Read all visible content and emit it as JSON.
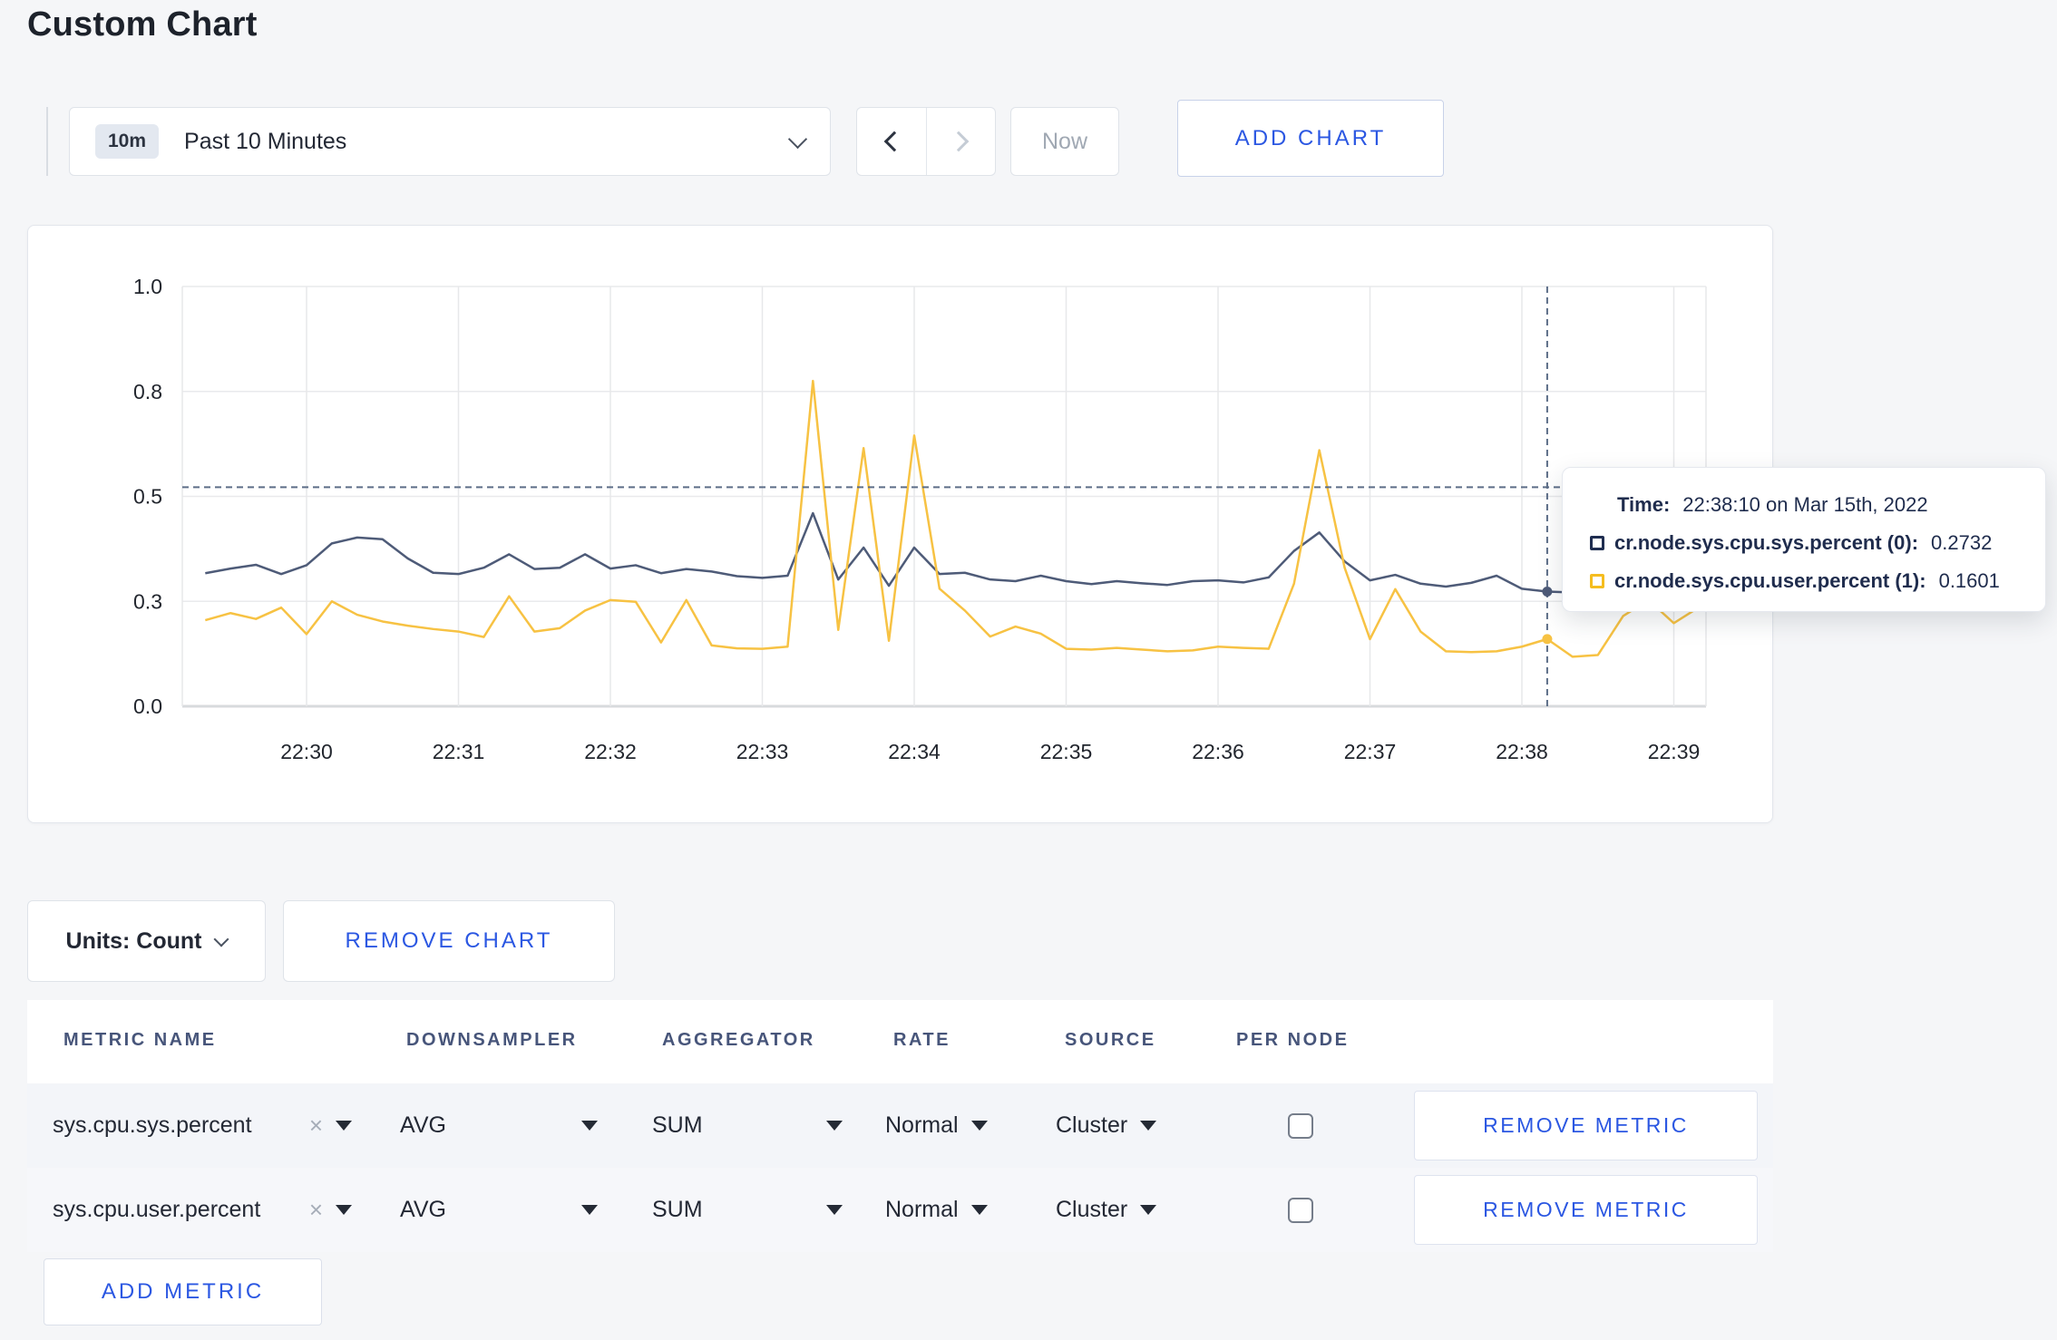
{
  "page": {
    "title": "Custom Chart"
  },
  "toolbar": {
    "range_badge": "10m",
    "range_label": "Past 10 Minutes",
    "prev_label": "previous-range",
    "next_label": "next-range",
    "now_label": "Now",
    "add_chart_label": "ADD CHART"
  },
  "chart_data": {
    "type": "line",
    "title": "",
    "xlabel": "",
    "ylabel": "",
    "ylim": [
      0,
      1
    ],
    "grid": true,
    "legend_position": "tooltip",
    "y_ticks": [
      {
        "v": 0.0,
        "label": "0.0"
      },
      {
        "v": 0.25,
        "label": "0.3"
      },
      {
        "v": 0.5,
        "label": "0.5"
      },
      {
        "v": 0.75,
        "label": "0.8"
      },
      {
        "v": 1.0,
        "label": "1.0"
      }
    ],
    "x_tick_labels": [
      "22:30",
      "22:31",
      "22:32",
      "22:33",
      "22:34",
      "22:35",
      "22:36",
      "22:37",
      "22:38",
      "22:39"
    ],
    "x_start_time": "22:29:20",
    "x_interval_seconds": 10,
    "x_start_min_rel_first_tick": -0.6667,
    "series": [
      {
        "name": "cr.node.sys.cpu.sys.percent (0)",
        "color": "#4e5b78",
        "values": [
          0.317,
          0.328,
          0.337,
          0.315,
          0.336,
          0.388,
          0.402,
          0.398,
          0.352,
          0.318,
          0.315,
          0.33,
          0.362,
          0.327,
          0.33,
          0.362,
          0.328,
          0.336,
          0.317,
          0.327,
          0.321,
          0.31,
          0.306,
          0.311,
          0.46,
          0.302,
          0.378,
          0.287,
          0.378,
          0.315,
          0.318,
          0.302,
          0.298,
          0.311,
          0.298,
          0.291,
          0.298,
          0.293,
          0.289,
          0.298,
          0.3,
          0.295,
          0.307,
          0.37,
          0.414,
          0.345,
          0.3,
          0.313,
          0.292,
          0.285,
          0.294,
          0.311,
          0.28,
          0.2732,
          0.271,
          0.28,
          0.268,
          0.276,
          0.27,
          0.273
        ]
      },
      {
        "name": "cr.node.sys.cpu.user.percent (1)",
        "color": "#f7c243",
        "values": [
          0.205,
          0.222,
          0.208,
          0.235,
          0.172,
          0.25,
          0.218,
          0.202,
          0.192,
          0.184,
          0.178,
          0.165,
          0.262,
          0.178,
          0.186,
          0.228,
          0.253,
          0.249,
          0.152,
          0.253,
          0.145,
          0.138,
          0.137,
          0.142,
          0.775,
          0.182,
          0.615,
          0.156,
          0.645,
          0.28,
          0.228,
          0.166,
          0.19,
          0.173,
          0.137,
          0.135,
          0.139,
          0.135,
          0.131,
          0.133,
          0.142,
          0.139,
          0.137,
          0.292,
          0.61,
          0.33,
          0.16,
          0.279,
          0.178,
          0.131,
          0.129,
          0.131,
          0.142,
          0.1601,
          0.118,
          0.122,
          0.215,
          0.253,
          0.198,
          0.236
        ]
      }
    ],
    "crosshair": {
      "time": "22:38:10",
      "min_rel_first_tick": 8.1667,
      "y_value": 0.522
    },
    "hover_points": [
      {
        "series": 0,
        "value": 0.2732
      },
      {
        "series": 1,
        "value": 0.1601
      }
    ]
  },
  "tooltip": {
    "time_label": "Time:",
    "time_value": "22:38:10 on Mar 15th, 2022",
    "rows": [
      {
        "name": "cr.node.sys.cpu.sys.percent (0):",
        "value": "0.2732",
        "color": "#1f2d50"
      },
      {
        "name": "cr.node.sys.cpu.user.percent (1):",
        "value": "0.1601",
        "color": "#f5bd1f"
      }
    ]
  },
  "chart_controls": {
    "units_label": "Units: Count",
    "remove_chart_label": "REMOVE CHART"
  },
  "metrics_table": {
    "headers": [
      "METRIC NAME",
      "DOWNSAMPLER",
      "AGGREGATOR",
      "RATE",
      "SOURCE",
      "PER NODE"
    ],
    "rows": [
      {
        "metric": "sys.cpu.sys.percent",
        "clear": "×",
        "downsampler": "AVG",
        "aggregator": "SUM",
        "rate": "Normal",
        "source": "Cluster",
        "per_node_checked": false,
        "remove_label": "REMOVE METRIC"
      },
      {
        "metric": "sys.cpu.user.percent",
        "clear": "×",
        "downsampler": "AVG",
        "aggregator": "SUM",
        "rate": "Normal",
        "source": "Cluster",
        "per_node_checked": false,
        "remove_label": "REMOVE METRIC"
      }
    ],
    "add_metric_label": "ADD METRIC"
  }
}
